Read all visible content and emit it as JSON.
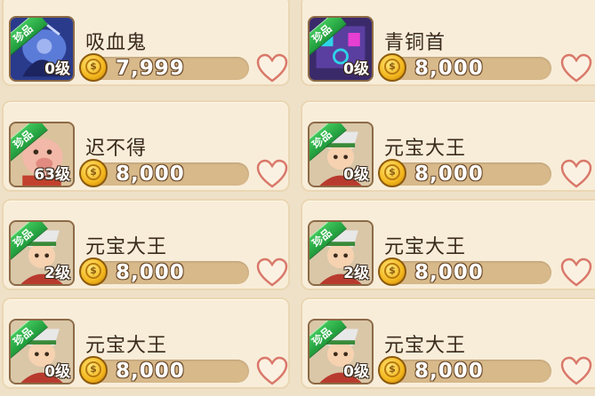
{
  "items": [
    {
      "name": "吸血鬼",
      "level": "0级",
      "price": "7,999",
      "tag": "珍品",
      "portrait": "vampire-portrait"
    },
    {
      "name": "青铜首",
      "level": "0级",
      "price": "8,000",
      "tag": "珍品",
      "portrait": "bronze-portrait"
    },
    {
      "name": "迟不得",
      "level": "63级",
      "price": "8,000",
      "tag": "珍品",
      "portrait": "pig-portrait"
    },
    {
      "name": "元宝大王",
      "level": "0级",
      "price": "8,000",
      "tag": "珍品",
      "portrait": "warrior-portrait"
    },
    {
      "name": "元宝大王",
      "level": "2级",
      "price": "8,000",
      "tag": "珍品",
      "portrait": "warrior-portrait"
    },
    {
      "name": "元宝大王",
      "level": "2级",
      "price": "8,000",
      "tag": "珍品",
      "portrait": "warrior-portrait"
    },
    {
      "name": "元宝大王",
      "level": "0级",
      "price": "8,000",
      "tag": "珍品",
      "portrait": "warrior-portrait"
    },
    {
      "name": "元宝大王",
      "level": "0级",
      "price": "8,000",
      "tag": "珍品",
      "portrait": "warrior-portrait"
    }
  ],
  "coin_icon": "gold-coin-icon",
  "favorite_icon": "heart-outline-icon",
  "colors": {
    "tag_green": "#2fb04a",
    "price_bar": "#d8b98a",
    "heart": "#d9786a",
    "card_bg": "#f8edd9"
  }
}
